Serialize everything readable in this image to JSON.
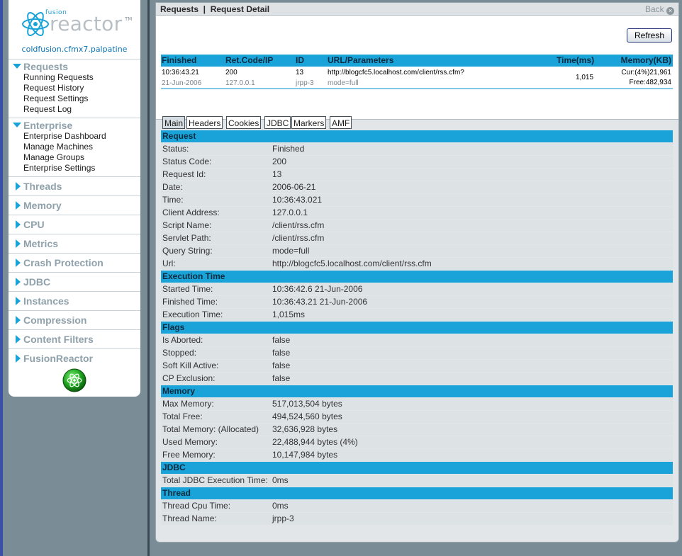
{
  "sidebar": {
    "logo_small": "fusion",
    "logo_big": "reactor",
    "logo_tm": "TM",
    "server": "coldfusion.cfmx7.palpatine",
    "sections": [
      {
        "label": "Requests",
        "items": [
          "Running Requests",
          "Request History",
          "Request Settings",
          "Request Log"
        ]
      },
      {
        "label": "Enterprise",
        "items": [
          "Enterprise Dashboard",
          "Manage Machines",
          "Manage Groups",
          "Enterprise Settings"
        ]
      },
      {
        "label": "Threads"
      },
      {
        "label": "Memory"
      },
      {
        "label": "CPU"
      },
      {
        "label": "Metrics"
      },
      {
        "label": "Crash Protection"
      },
      {
        "label": "JDBC"
      },
      {
        "label": "Instances"
      },
      {
        "label": "Compression"
      },
      {
        "label": "Content Filters"
      },
      {
        "label": "FusionReactor"
      }
    ]
  },
  "header": {
    "breadcrumb": "Requests  |  Request Detail",
    "back_label": "Back",
    "refresh_label": "Refresh"
  },
  "summary": {
    "columns": [
      "Finished",
      "Ret.Code/IP",
      "ID",
      "URL/Parameters",
      "Time(ms)",
      "Memory(KB)"
    ],
    "row": {
      "status": "10:36:43.21",
      "date": "21-Jun-2006",
      "code": "200",
      "ip": "127.0.0.1",
      "id": "13",
      "thread": "jrpp-3",
      "url": "http://blogcfc5.localhost.com/client/rss.cfm?",
      "params": "mode=full",
      "time": "1,015",
      "mem_cur": "Cur:(4%)21,961",
      "mem_free": "Free:482,934"
    }
  },
  "tabs": [
    "Main",
    "Headers",
    "Cookies",
    "JDBC",
    "Markers",
    "AMF"
  ],
  "detail": [
    {
      "title": "Request",
      "rows": [
        [
          "Status:",
          "Finished"
        ],
        [
          "Status Code:",
          "200"
        ],
        [
          "Request Id:",
          "13"
        ],
        [
          "Date:",
          "2006-06-21"
        ],
        [
          "Time:",
          "10:36:43.021"
        ],
        [
          "Client Address:",
          "127.0.0.1"
        ],
        [
          "Script Name:",
          "/client/rss.cfm"
        ],
        [
          "Servlet Path:",
          "/client/rss.cfm"
        ],
        [
          "Query String:",
          "mode=full"
        ],
        [
          "Url:",
          "http://blogcfc5.localhost.com/client/rss.cfm"
        ]
      ]
    },
    {
      "title": "Execution Time",
      "rows": [
        [
          "Started Time:",
          "10:36:42.6 21-Jun-2006"
        ],
        [
          "Finished Time:",
          "10:36:43.21 21-Jun-2006"
        ],
        [
          "Execution Time:",
          "1,015ms"
        ]
      ]
    },
    {
      "title": "Flags",
      "rows": [
        [
          "Is Aborted:",
          "false"
        ],
        [
          "Stopped:",
          "false"
        ],
        [
          "Soft Kill Active:",
          "false"
        ],
        [
          "CP Exclusion:",
          "false"
        ]
      ]
    },
    {
      "title": "Memory",
      "rows": [
        [
          "Max Memory:",
          "517,013,504 bytes"
        ],
        [
          "Total Free:",
          "494,524,560 bytes"
        ],
        [
          "Total Memory: (Allocated)",
          "32,636,928 bytes"
        ],
        [
          "Used Memory:",
          "22,488,944 bytes (4%)"
        ],
        [
          "Free Memory:",
          "10,147,984 bytes"
        ]
      ]
    },
    {
      "title": "JDBC",
      "rows": [
        [
          "Total JDBC Execution Time:",
          "0ms"
        ]
      ]
    },
    {
      "title": "Thread",
      "rows": [
        [
          "Thread Cpu Time:",
          "0ms"
        ],
        [
          "Thread Name:",
          "jrpp-3"
        ]
      ]
    }
  ]
}
